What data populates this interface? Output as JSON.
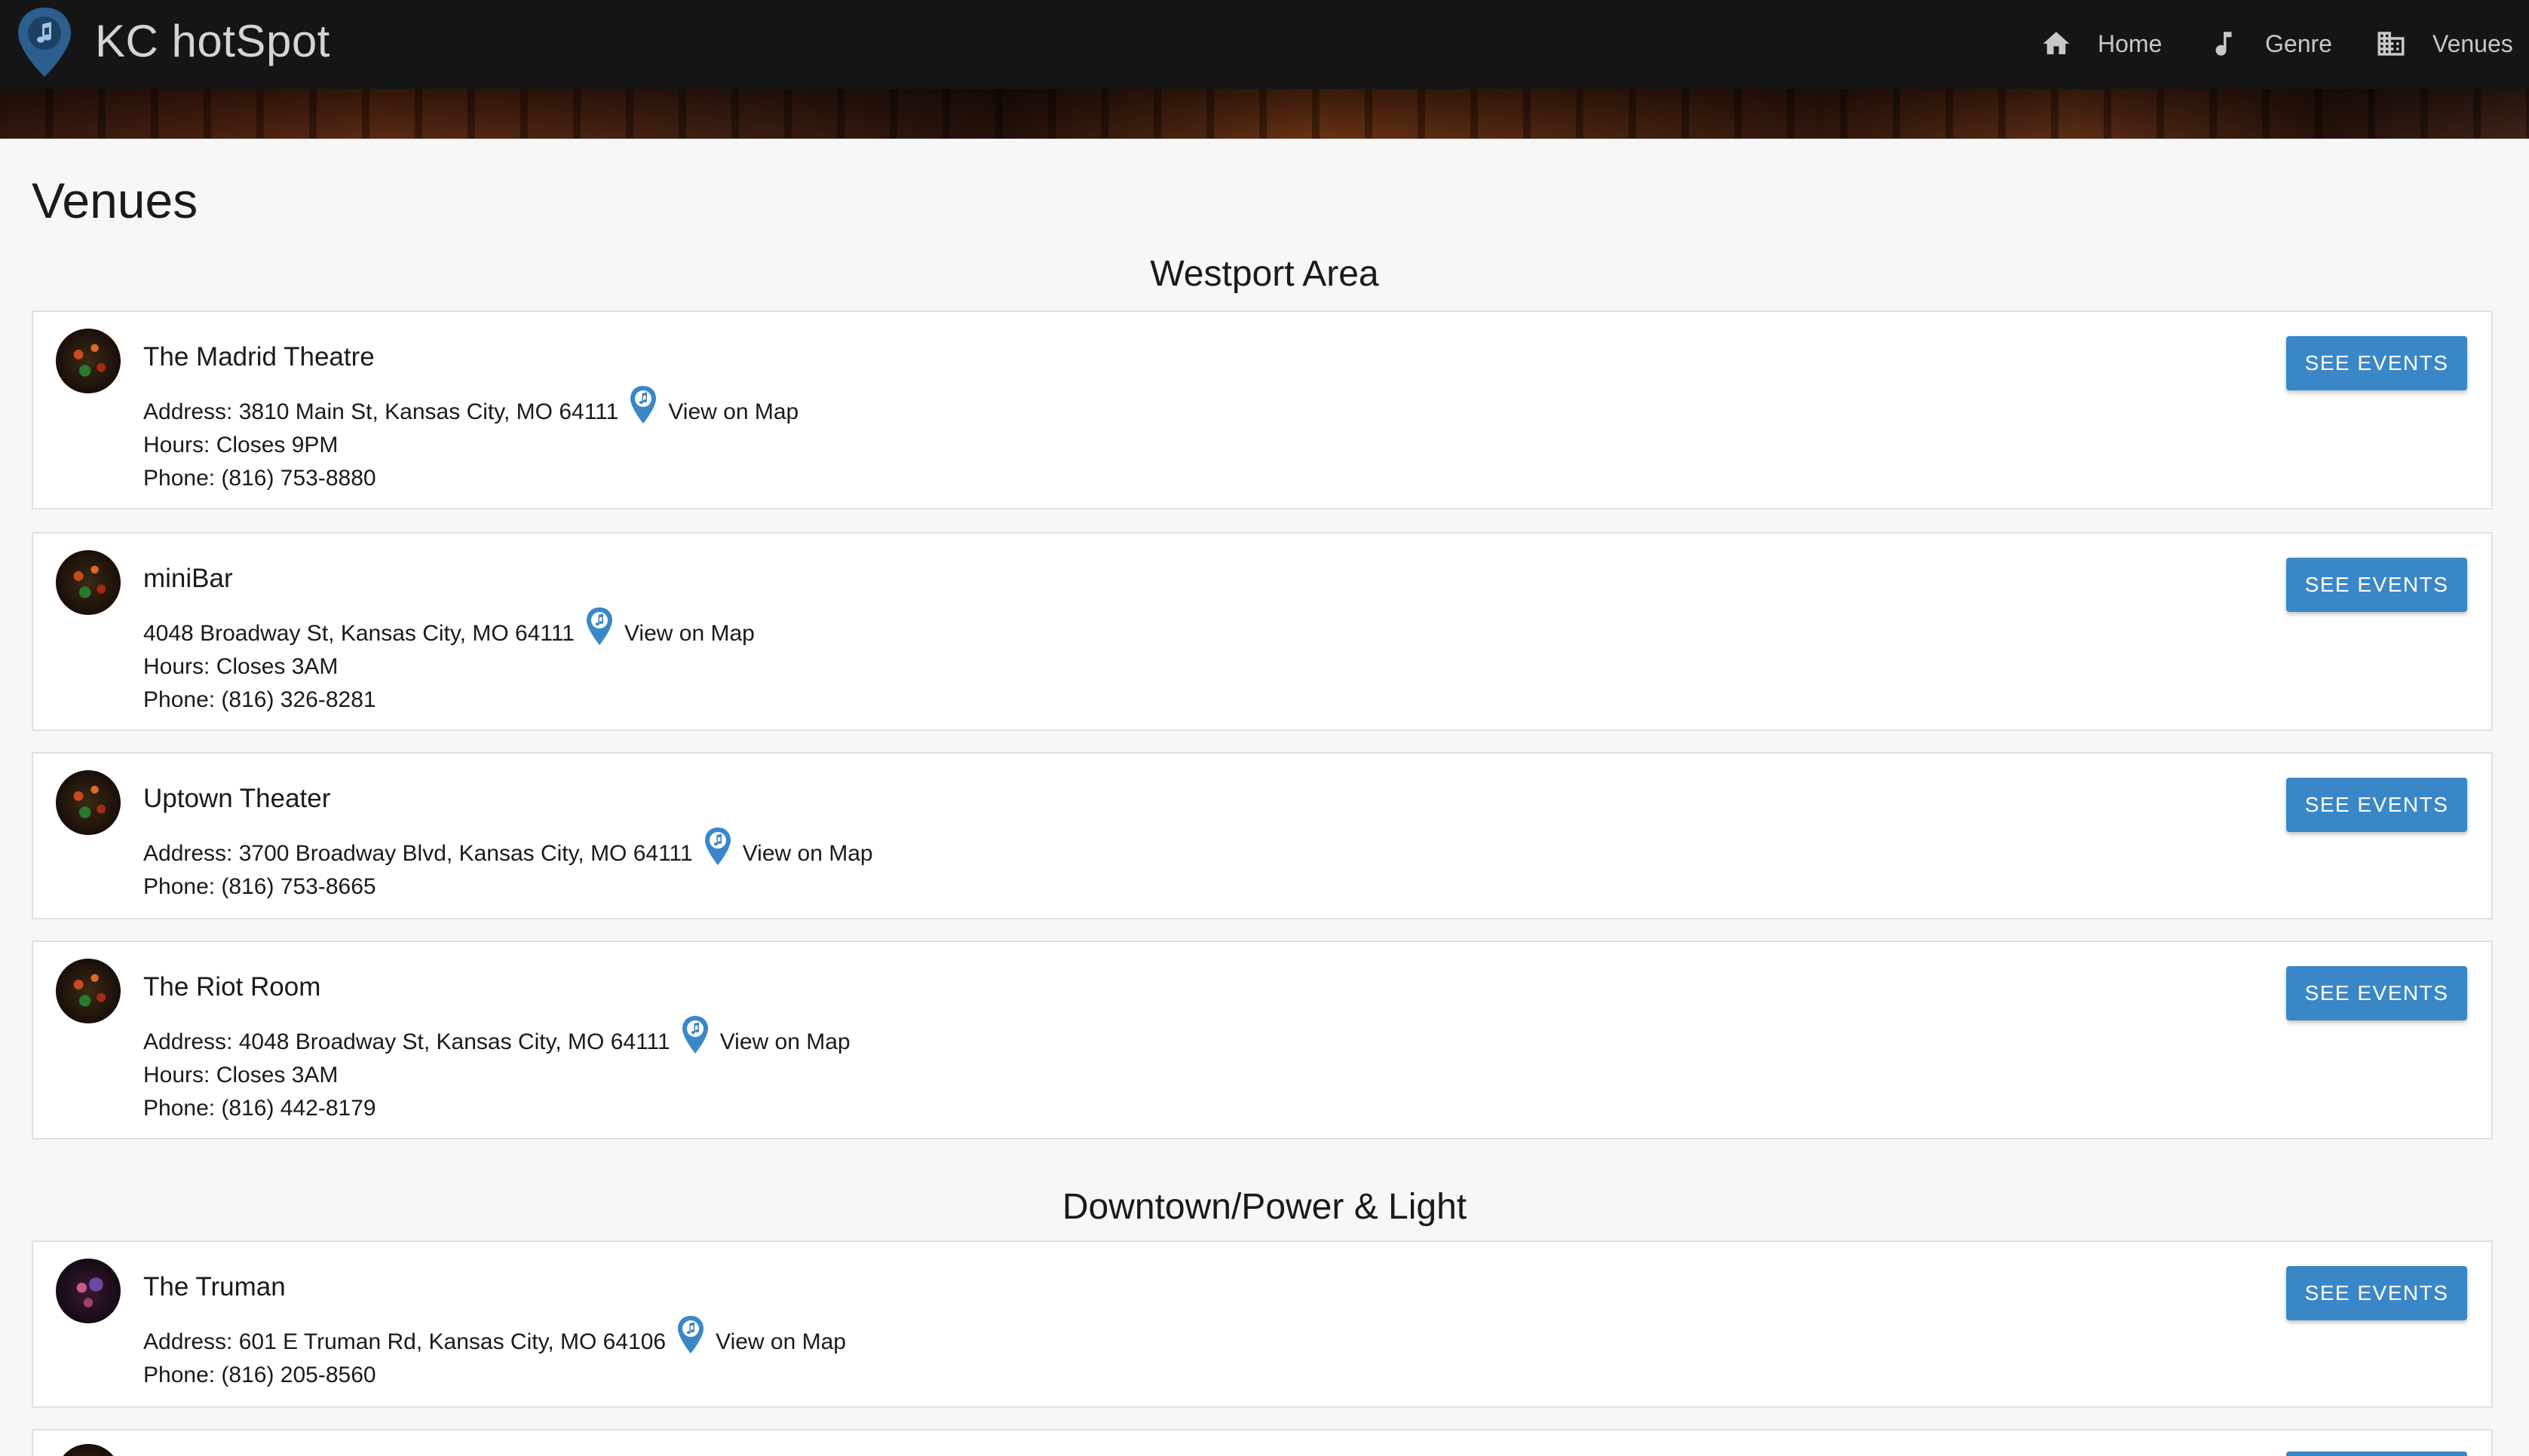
{
  "app": {
    "brand": "KC hotSpot",
    "nav": [
      {
        "label": "Home",
        "icon": "home-icon"
      },
      {
        "label": "Genre",
        "icon": "music-note-icon"
      },
      {
        "label": "Venues",
        "icon": "building-icon"
      }
    ]
  },
  "page": {
    "title": "Venues"
  },
  "colors": {
    "accent": "#3a87c8",
    "navbar": "#151515",
    "pin": "#3a87c8"
  },
  "sections": [
    {
      "heading": "Westport Area",
      "venues": [
        {
          "name": "The Madrid Theatre",
          "address": "Address: 3810 Main St, Kansas City, MO 64111",
          "map_link": "View on Map",
          "hours": "Hours: Closes 9PM",
          "phone": "Phone: (816) 753-8880",
          "button": "SEE EVENTS"
        },
        {
          "name": "miniBar",
          "address": "4048 Broadway St, Kansas City, MO 64111",
          "map_link": "View on Map",
          "hours": "Hours: Closes 3AM",
          "phone": "Phone: (816) 326-8281",
          "button": "SEE EVENTS"
        },
        {
          "name": "Uptown Theater",
          "address": "Address: 3700 Broadway Blvd, Kansas City, MO 64111",
          "map_link": "View on Map",
          "phone": "Phone: (816) 753-8665",
          "button": "SEE EVENTS"
        },
        {
          "name": "The Riot Room",
          "address": "Address: 4048 Broadway St, Kansas City, MO 64111",
          "map_link": "View on Map",
          "hours": "Hours: Closes 3AM",
          "phone": "Phone: (816) 442-8179",
          "button": "SEE EVENTS"
        }
      ]
    },
    {
      "heading": "Downtown/Power & Light",
      "venues": [
        {
          "name": "The Truman",
          "address": "Address: 601 E Truman Rd, Kansas City, MO 64106",
          "map_link": "View on Map",
          "phone": "Phone: (816) 205-8560",
          "button": "SEE EVENTS"
        }
      ]
    }
  ]
}
